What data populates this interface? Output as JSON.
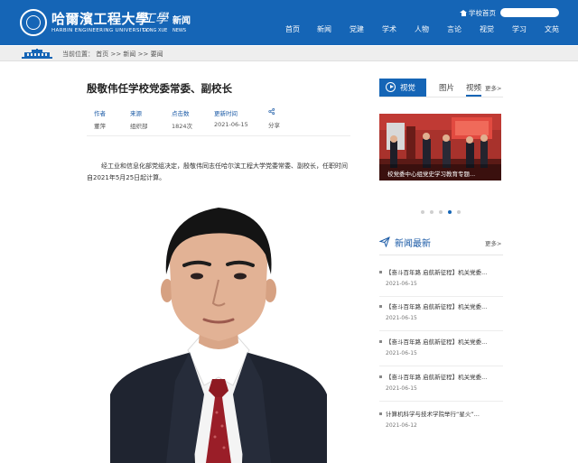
{
  "header": {
    "logo_cn": "哈爾濱工程大學",
    "logo_en": "HARBIN ENGINEERING UNIVERSITY",
    "gongxue": "工學",
    "gongxue_en": "GONG XUE",
    "news_cn": "新闻",
    "news_en": "NEWS",
    "school_home": "学校首页",
    "brand_color": "#1565b6",
    "nav": [
      "首页",
      "新闻",
      "党建",
      "学术",
      "人物",
      "言论",
      "视觉",
      "学习",
      "文苑"
    ]
  },
  "breadcrumb": "当前位置： 首页 >> 新闻 >> 要闻",
  "article": {
    "title": "殷敬伟任学校党委常委、副校长",
    "meta": [
      {
        "label": "作者",
        "value": "董萍"
      },
      {
        "label": "来源",
        "value": "组织部"
      },
      {
        "label": "点击数",
        "value": "1824次"
      },
      {
        "label": "更新时间",
        "value": "2021-06-15"
      },
      {
        "label": "",
        "value": "分享"
      }
    ],
    "paragraph": "经工业和信息化部党组决定，殷敬伟同志任哈尔滨工程大学党委常委、副校长，任职时间自2021年5月25日起计算。"
  },
  "sidebar": {
    "tabs": [
      "视觉",
      "图片",
      "视频"
    ],
    "more": "更多>",
    "video_caption": "校党委中心组党史学习教育专题...",
    "carousel_count": 5,
    "carousel_active": 4,
    "news_title": "新闻最新",
    "news_more": "更多>",
    "news": [
      {
        "title": "【奋斗百年路 启航新征程】机关党委...",
        "date": "2021-06-15"
      },
      {
        "title": "【奋斗百年路 启航新征程】机关党委...",
        "date": "2021-06-15"
      },
      {
        "title": "【奋斗百年路 启航新征程】机关党委...",
        "date": "2021-06-15"
      },
      {
        "title": "【奋斗百年路 启航新征程】机关党委...",
        "date": "2021-06-15"
      },
      {
        "title": "计算机科学与技术学院举行“星火”...",
        "date": "2021-06-12"
      }
    ]
  }
}
